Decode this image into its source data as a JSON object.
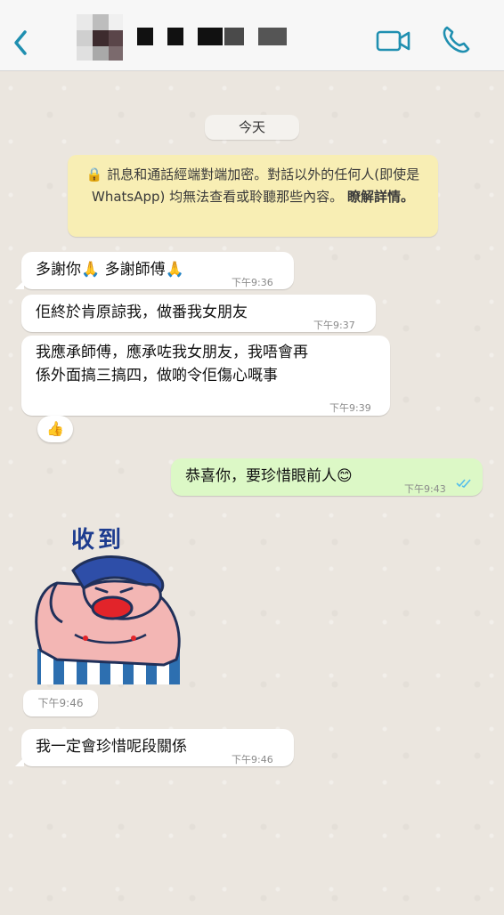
{
  "header": {
    "back_icon": "chevron-left-icon",
    "video_icon": "video-call-icon",
    "phone_icon": "phone-call-icon",
    "accent_color": "#1f8fb0"
  },
  "chat": {
    "date_label": "今天",
    "notice": {
      "text": "訊息和通話經端對端加密。對話以外的任何人(即使是 WhatsApp) 均無法查看或聆聽那些內容。",
      "link": "瞭解詳情。"
    },
    "messages": [
      {
        "direction": "in",
        "text": "多謝你🙏 多謝師傅🙏",
        "time": "下午9:36"
      },
      {
        "direction": "in",
        "text": "佢終於肯原諒我，做番我女朋友",
        "time": "下午9:37"
      },
      {
        "direction": "in",
        "line1": "我應承師傅，應承咗我女朋友，我唔會再",
        "line2": "係外面搞三搞四，做啲令佢傷心嘅事",
        "time": "下午9:39",
        "reaction": "👍"
      },
      {
        "direction": "out",
        "text": "恭喜你，要珍惜眼前人😊",
        "time": "下午9:43",
        "status": "read"
      },
      {
        "direction": "in",
        "type": "sticker",
        "sticker_caption": "收到",
        "time": "下午9:46"
      },
      {
        "direction": "in",
        "text": "我一定會珍惜呢段關係",
        "time": "下午9:46"
      }
    ],
    "colors": {
      "incoming_bubble": "#ffffff",
      "outgoing_bubble": "#dcf8c6",
      "notice_bg": "#f8eeb4",
      "read_ticks": "#53bdeb"
    }
  }
}
